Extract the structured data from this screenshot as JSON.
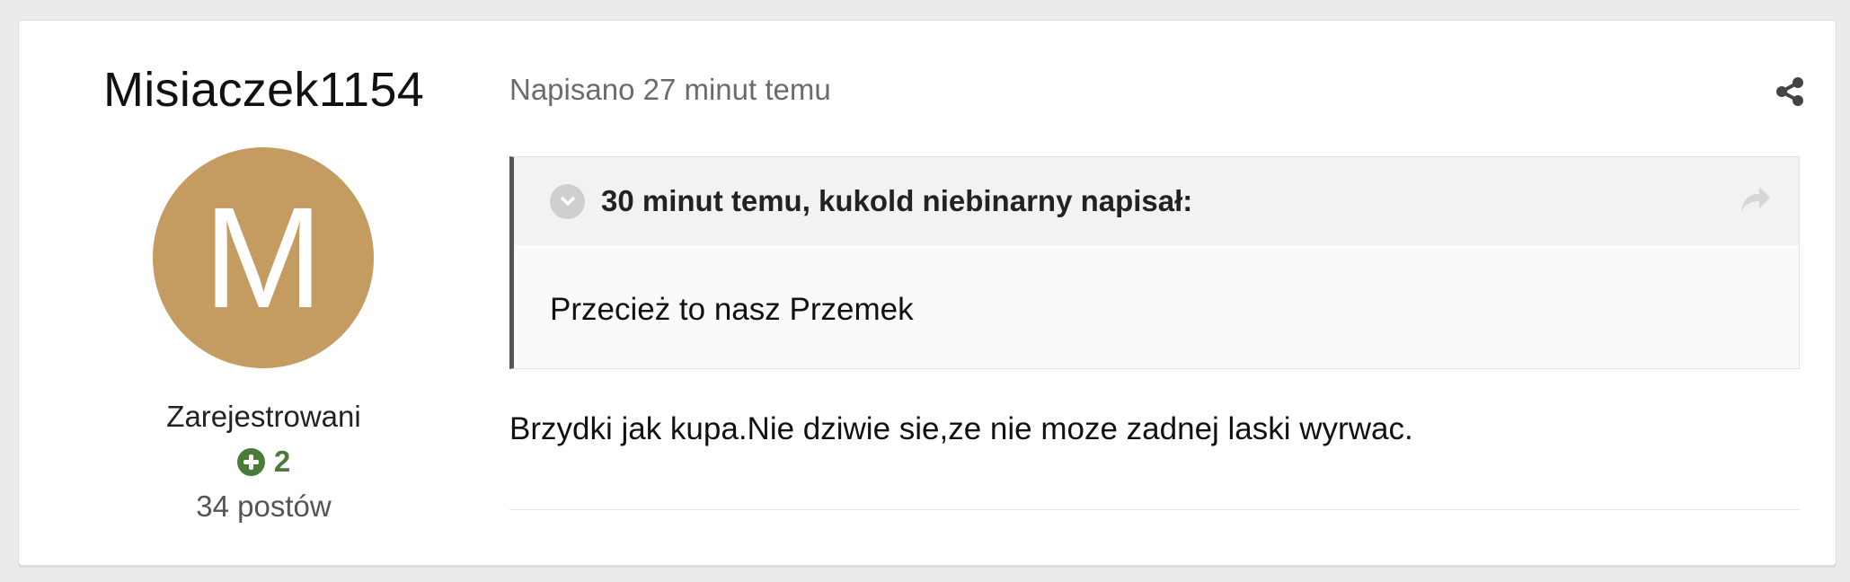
{
  "author": {
    "name": "Misiaczek1154",
    "avatar_letter": "M",
    "avatar_color": "#c49c62",
    "group": "Zarejestrowani",
    "reputation": "2",
    "reputation_icon": "plus-circle-icon",
    "posts_count": "34 postów"
  },
  "post": {
    "meta": "Napisano 27 minut temu",
    "share_icon": "share-icon",
    "quote": {
      "toggle_icon": "chevron-down-icon",
      "citation": "30 minut temu, kukold niebinarny napisał:",
      "link_icon": "forward-arrow-icon",
      "text": "Przecież to nasz Przemek"
    },
    "text": "Brzydki jak kupa.Nie dziwie sie,ze nie moze zadnej laski wyrwac."
  },
  "colors": {
    "reputation_green": "#4b7a3a",
    "quote_border": "#555555",
    "page_background": "#ebebeb"
  }
}
